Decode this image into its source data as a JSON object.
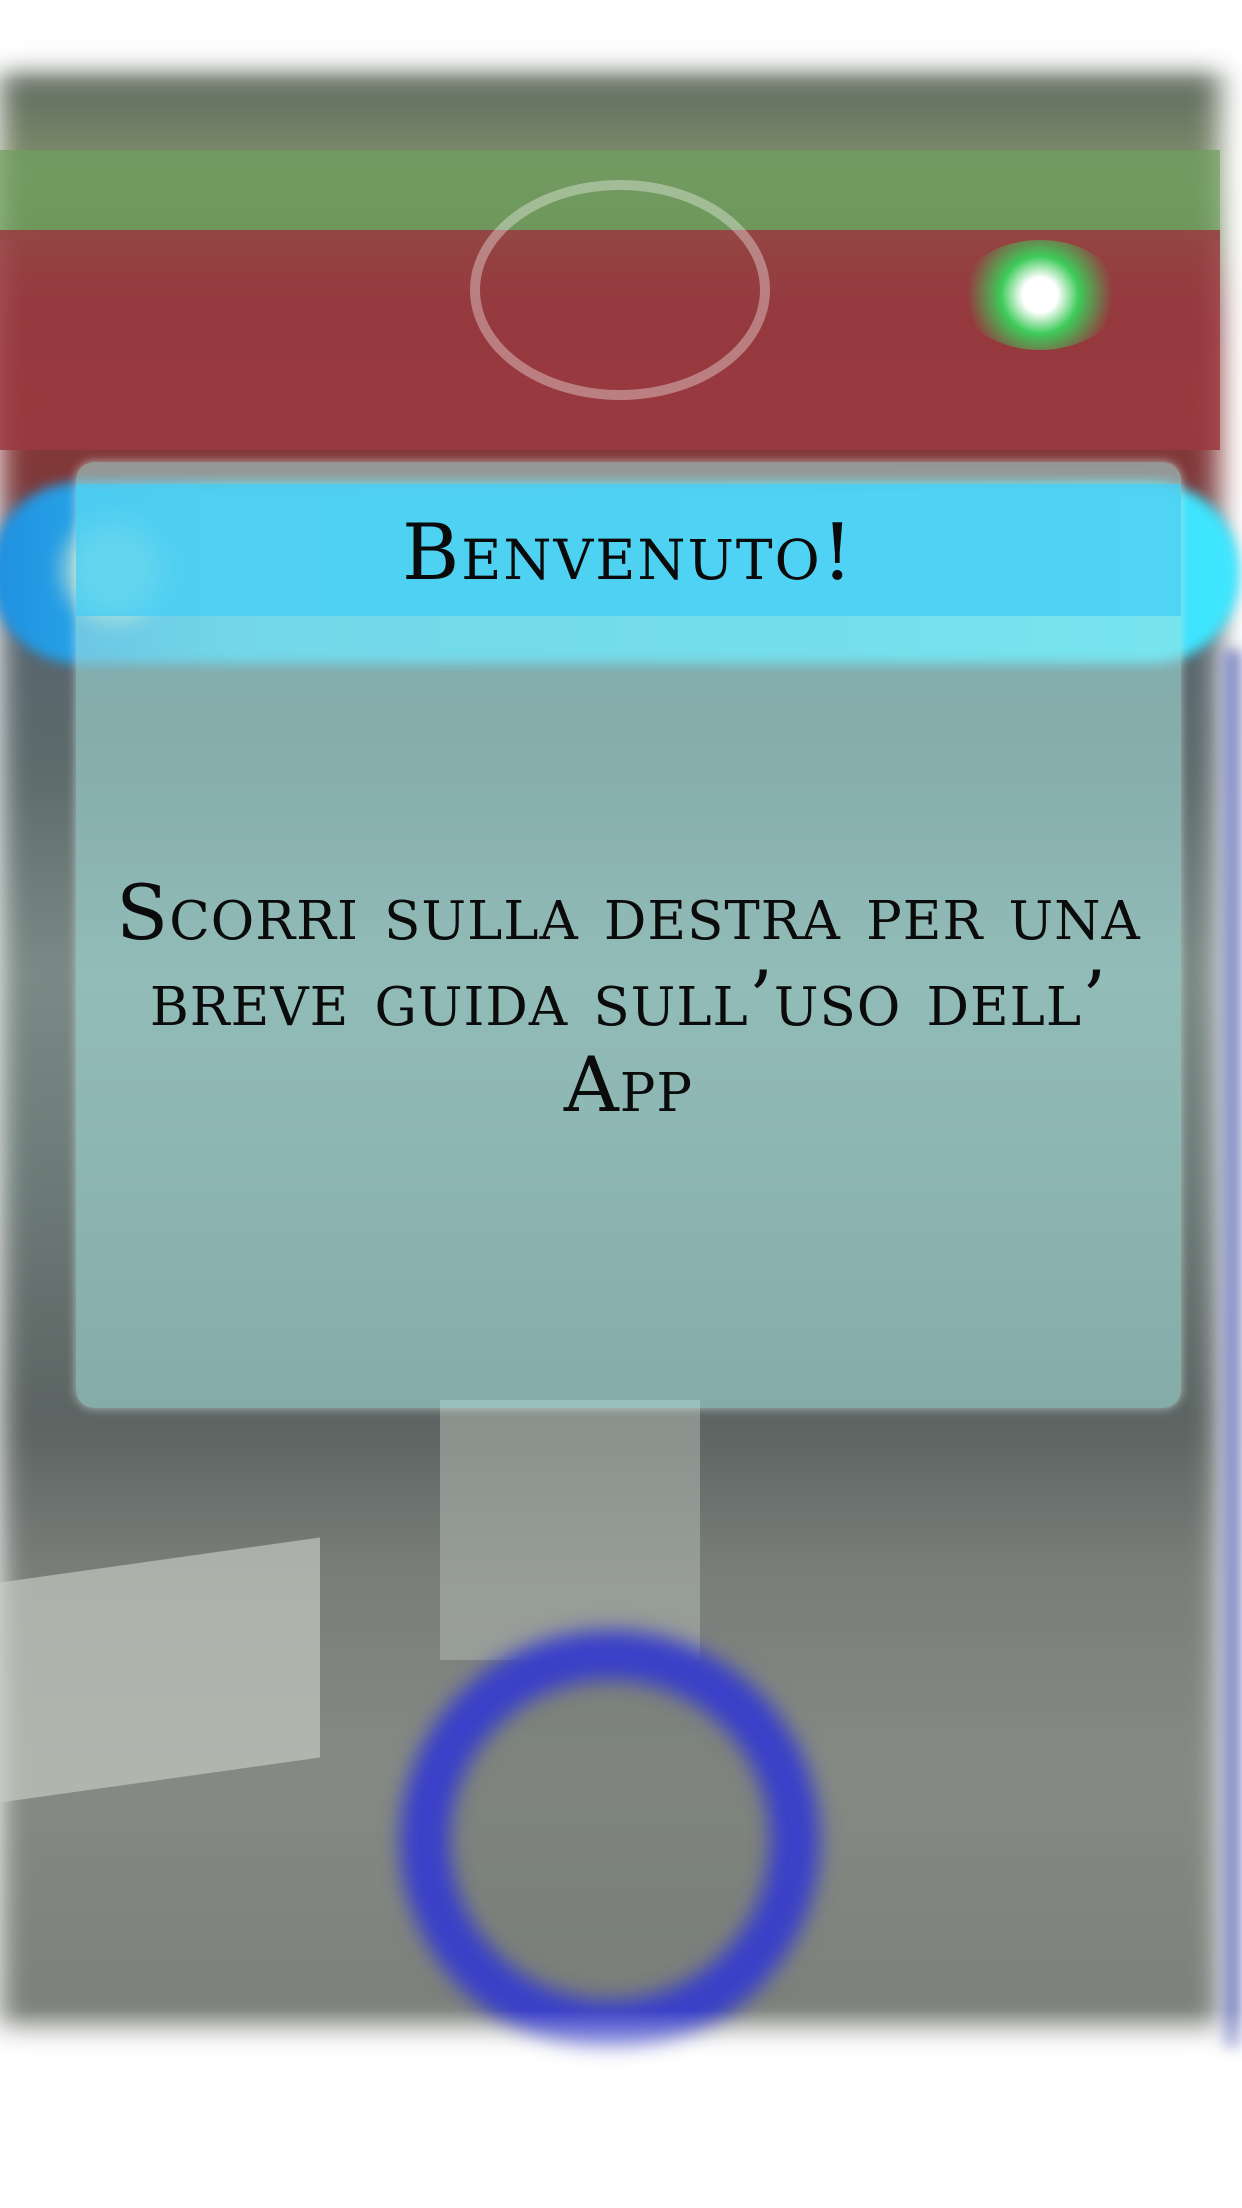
{
  "dialog": {
    "title": "Benvenuto!",
    "message": "Scorri sulla destra per una breve guida sull’uso dell’ App"
  },
  "colors": {
    "header_cyan": "#41cdf5",
    "dialog_teal": "#a5e6e2",
    "ring_blue": "#3a40c8",
    "track_red": "#9a3a3f"
  }
}
